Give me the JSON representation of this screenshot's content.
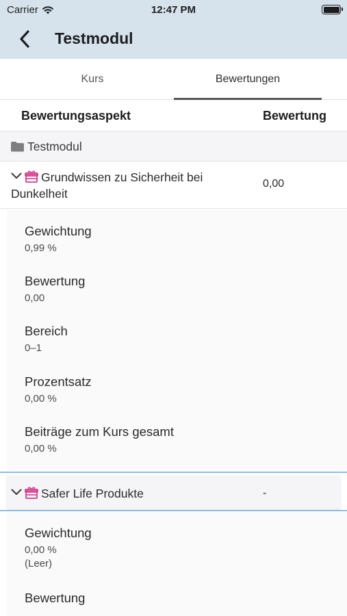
{
  "status_bar": {
    "carrier": "Carrier",
    "time": "12:47 PM"
  },
  "nav": {
    "title": "Testmodul"
  },
  "tabs": [
    {
      "label": "Kurs",
      "active": false
    },
    {
      "label": "Bewertungen",
      "active": true
    }
  ],
  "table": {
    "headers": {
      "aspect": "Bewertungsaspekt",
      "grade": "Bewertung"
    },
    "category": {
      "label": "Testmodul"
    },
    "items": [
      {
        "label": "Grundwissen zu Sicherheit bei Dunkelheit",
        "value": "0,00",
        "details": [
          {
            "label": "Gewichtung",
            "value": "0,99 %"
          },
          {
            "label": "Bewertung",
            "value": "0,00"
          },
          {
            "label": "Bereich",
            "value": "0–1"
          },
          {
            "label": "Prozentsatz",
            "value": "0,00 %"
          },
          {
            "label": "Beiträge zum Kurs gesamt",
            "value": "0,00 %"
          }
        ]
      },
      {
        "label": "Safer Life Produkte",
        "value": "-",
        "details": [
          {
            "label": "Gewichtung",
            "value": "0,00 %",
            "sub": "(Leer)"
          },
          {
            "label": "Bewertung"
          }
        ]
      }
    ]
  },
  "colors": {
    "header_bg": "#d6e3ec",
    "accent_pink": "#d63b8f",
    "selection_border": "#8cbde6"
  },
  "icons": [
    "wifi-icon",
    "battery-icon",
    "back-chevron-icon",
    "folder-icon",
    "chevron-down-icon",
    "gift-icon"
  ]
}
